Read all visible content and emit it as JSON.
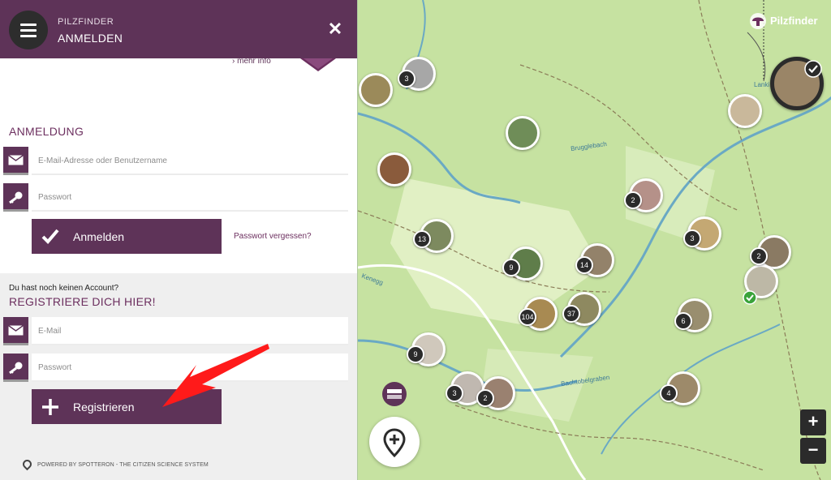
{
  "header": {
    "brand": "PILZFINDER",
    "title": "ANMELDEN"
  },
  "top": {
    "mehr_info": "› mehr info"
  },
  "login": {
    "heading": "ANMELDUNG",
    "email_placeholder": "E-Mail-Adresse oder Benutzername",
    "password_placeholder": "Passwort",
    "submit_label": "Anmelden",
    "forgot_label": "Passwort vergessen?"
  },
  "register": {
    "no_account": "Du hast noch keinen Account?",
    "heading": "REGISTRIERE DICH HIER!",
    "email_placeholder": "E-Mail",
    "password_placeholder": "Passwort",
    "submit_label": "Registrieren"
  },
  "footer": {
    "powered": "POWERED BY SPOTTERON - THE CITIZEN SCIENCE SYSTEM"
  },
  "map": {
    "logo": "Pilzfinder",
    "clusters": [
      {
        "count": "3"
      },
      {
        "count": "2"
      },
      {
        "count": "13"
      },
      {
        "count": "9"
      },
      {
        "count": "14"
      },
      {
        "count": "3"
      },
      {
        "count": "2"
      },
      {
        "count": "104"
      },
      {
        "count": "37"
      },
      {
        "count": "6"
      },
      {
        "count": "9"
      },
      {
        "count": "3"
      },
      {
        "count": "2"
      },
      {
        "count": "4"
      }
    ],
    "street_labels": [
      "Brugglebach",
      "Kenegg",
      "Bachtobelgraben",
      "Lanki"
    ],
    "zoom_in": "+",
    "zoom_out": "−"
  },
  "colors": {
    "brand": "#5e3358",
    "map_bg": "#c9e3a6",
    "arrow": "#ff0000"
  }
}
